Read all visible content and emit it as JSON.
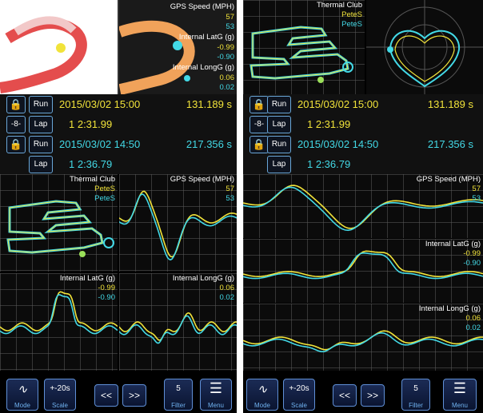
{
  "left": {
    "top_panel": {
      "title": "GPS Speed (MPH)",
      "speed_yellow": "57",
      "speed_cyan": "53",
      "latg_title": "Internal LatG (g)",
      "latg_yellow": "-0.99",
      "latg_cyan": "-0.90",
      "longg_title": "Internal LongG (g)",
      "longg_yellow": "0.06",
      "longg_cyan": "0.02"
    },
    "runs": [
      {
        "run_label": "Run",
        "lap_label": "Lap",
        "date": "2015/03/02 15:00",
        "duration": "131.189 s",
        "lap_time": "1 2:31.99"
      },
      {
        "run_label": "Run",
        "lap_label": "Lap",
        "date": "2015/03/02 14:50",
        "duration": "217.356 s",
        "lap_time": "1 2:36.79"
      }
    ],
    "map": {
      "track": "Thermal Club",
      "driver_yellow": "PeteS",
      "driver_cyan": "PeteS"
    },
    "speed": {
      "title": "GPS Speed (MPH)",
      "yellow": "57",
      "cyan": "53"
    },
    "latg": {
      "title": "Internal LatG (g)",
      "yellow": "-0.99",
      "cyan": "-0.90"
    },
    "longg": {
      "title": "Internal LongG (g)",
      "yellow": "0.06",
      "cyan": "0.02"
    }
  },
  "right": {
    "map": {
      "track": "Thermal Club",
      "driver_yellow": "PeteS",
      "driver_cyan": "PeteS"
    },
    "runs": [
      {
        "run_label": "Run",
        "lap_label": "Lap",
        "date": "2015/03/02 15:00",
        "duration": "131.189 s",
        "lap_time": "1 2:31.99"
      },
      {
        "run_label": "Run",
        "lap_label": "Lap",
        "date": "2015/03/02 14:50",
        "duration": "217.356 s",
        "lap_time": "1 2:36.79"
      }
    ],
    "speed": {
      "title": "GPS Speed (MPH)",
      "yellow": "57",
      "cyan": "53"
    },
    "latg": {
      "title": "Internal LatG (g)",
      "yellow": "-0.99",
      "cyan": "-0.90"
    },
    "longg": {
      "title": "Internal LongG (g)",
      "yellow": "0.06",
      "cyan": "0.02"
    }
  },
  "toolbar": {
    "mode_label": "Mode",
    "scale_value": "+-20s",
    "scale_label": "Scale",
    "prev_label": "<<",
    "next_label": ">>",
    "filter_value": "5",
    "filter_label": "Filter",
    "menu_label": "Menu"
  },
  "icons": {
    "lock": "lock-icon",
    "sync": "sync-icon",
    "mode": "mode-graph-icon",
    "menu": "hamburger-icon"
  },
  "colors": {
    "yellow_trace": "#f1e33a",
    "cyan_trace": "#43d9e6",
    "button_border": "#6aa7d8"
  }
}
